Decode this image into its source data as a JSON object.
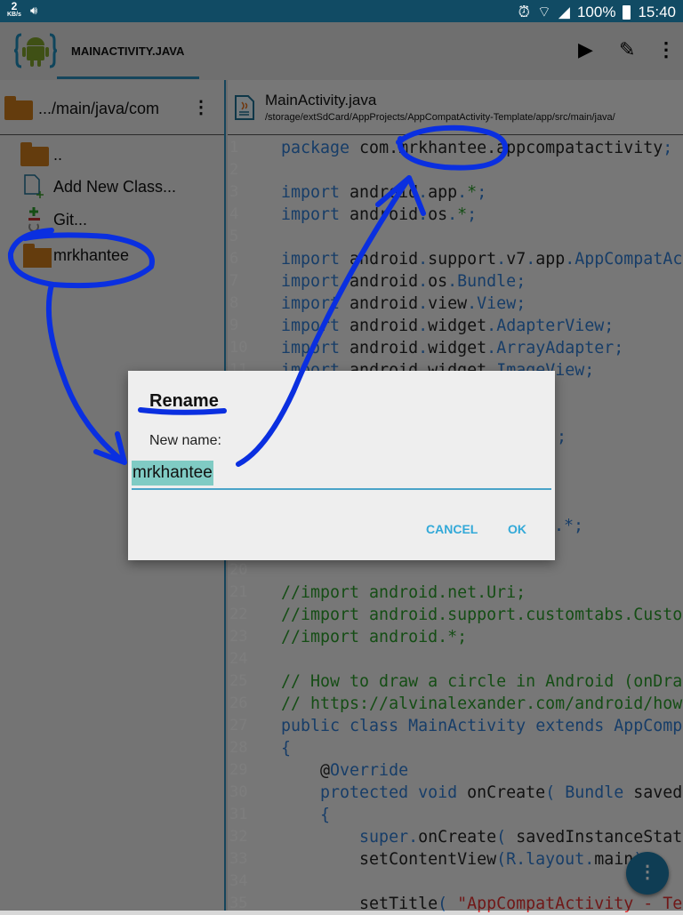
{
  "status_bar": {
    "speed": "2",
    "speed_unit": "KB/s",
    "battery": "100%",
    "time": "15:40"
  },
  "toolbar": {
    "tab_title": "MAINACTIVITY.JAVA",
    "icons": [
      "android-logo-icon",
      "play-icon",
      "pencil-icon",
      "more-vert-icon"
    ]
  },
  "sidebar": {
    "path": ".../main/java/com",
    "items": [
      {
        "label": "..",
        "icon": "folder-icon"
      },
      {
        "label": "Add New Class...",
        "icon": "new-file-icon"
      },
      {
        "label": "Git...",
        "icon": "git-icon"
      },
      {
        "label": "mrkhantee",
        "icon": "folder-icon"
      }
    ]
  },
  "editor": {
    "file_name": "MainActivity.java",
    "file_path": "/storage/extSdCard/AppProjects/AppCompatActivity-Template/app/src/main/java/",
    "lines": [
      {
        "n": "1",
        "t": [
          [
            "package",
            "k"
          ],
          [
            " com.mrkhantee.appcompatactivity",
            ""
          ],
          [
            ";",
            "p"
          ]
        ]
      },
      {
        "n": "2",
        "t": []
      },
      {
        "n": "3",
        "t": [
          [
            "import",
            "k"
          ],
          [
            " android",
            ""
          ],
          [
            ".",
            "p"
          ],
          [
            "app",
            ""
          ],
          [
            ".",
            "p"
          ],
          [
            "*",
            "c"
          ],
          [
            ";",
            "p"
          ]
        ]
      },
      {
        "n": "4",
        "t": [
          [
            "import",
            "k"
          ],
          [
            " android",
            ""
          ],
          [
            ".",
            "p"
          ],
          [
            "os",
            ""
          ],
          [
            ".",
            "p"
          ],
          [
            "*",
            "c"
          ],
          [
            ";",
            "p"
          ]
        ]
      },
      {
        "n": "5",
        "t": []
      },
      {
        "n": "6",
        "t": [
          [
            "import",
            "k"
          ],
          [
            " android",
            ""
          ],
          [
            ".",
            "p"
          ],
          [
            "support",
            ""
          ],
          [
            ".",
            "p"
          ],
          [
            "v7",
            ""
          ],
          [
            ".",
            "p"
          ],
          [
            "app",
            ""
          ],
          [
            ".",
            "p"
          ],
          [
            "AppCompatAc",
            "p"
          ]
        ]
      },
      {
        "n": "7",
        "t": [
          [
            "import",
            "k"
          ],
          [
            " android",
            ""
          ],
          [
            ".",
            "p"
          ],
          [
            "os",
            ""
          ],
          [
            ".",
            "p"
          ],
          [
            "Bundle",
            "p"
          ],
          [
            ";",
            "p"
          ]
        ]
      },
      {
        "n": "8",
        "t": [
          [
            "import",
            "k"
          ],
          [
            " android",
            ""
          ],
          [
            ".",
            "p"
          ],
          [
            "view",
            ""
          ],
          [
            ".",
            "p"
          ],
          [
            "View",
            "p"
          ],
          [
            ";",
            "p"
          ]
        ]
      },
      {
        "n": "9",
        "t": [
          [
            "import",
            "k"
          ],
          [
            " android",
            ""
          ],
          [
            ".",
            "p"
          ],
          [
            "widget",
            ""
          ],
          [
            ".",
            "p"
          ],
          [
            "AdapterView",
            "p"
          ],
          [
            ";",
            "p"
          ]
        ]
      },
      {
        "n": "10",
        "t": [
          [
            "import",
            "k"
          ],
          [
            " android",
            ""
          ],
          [
            ".",
            "p"
          ],
          [
            "widget",
            ""
          ],
          [
            ".",
            "p"
          ],
          [
            "ArrayAdapter",
            "p"
          ],
          [
            ";",
            "p"
          ]
        ]
      },
      {
        "n": "11",
        "t": [
          [
            "import",
            "k"
          ],
          [
            " android",
            ""
          ],
          [
            ".",
            "p"
          ],
          [
            "widget",
            ""
          ],
          [
            ".",
            "p"
          ],
          [
            "ImageView",
            "p"
          ],
          [
            ";",
            "p"
          ]
        ]
      },
      {
        "n": "20",
        "t": []
      },
      {
        "n": "21",
        "t": [
          [
            "//import android.net.Uri;",
            "c"
          ]
        ]
      },
      {
        "n": "22",
        "t": [
          [
            "//import android.support.customtabs.Custo",
            "c"
          ]
        ]
      },
      {
        "n": "23",
        "t": [
          [
            "//import android.*;",
            "c"
          ]
        ]
      },
      {
        "n": "24",
        "t": []
      },
      {
        "n": "25",
        "t": [
          [
            "// How to draw a circle in Android (onDra",
            "c"
          ]
        ]
      },
      {
        "n": "26",
        "t": [
          [
            "// https://alvinalexander.com/android/how",
            "c"
          ]
        ]
      },
      {
        "n": "27",
        "t": [
          [
            "public class",
            "k"
          ],
          [
            " ",
            ""
          ],
          [
            "MainActivity",
            "p"
          ],
          [
            " ",
            ""
          ],
          [
            "extends",
            "k"
          ],
          [
            " ",
            ""
          ],
          [
            "AppComp",
            "p"
          ]
        ]
      },
      {
        "n": "28",
        "t": [
          [
            "{",
            "p"
          ]
        ]
      },
      {
        "n": "29",
        "t": [
          [
            "    @",
            ""
          ],
          [
            "Override",
            "p"
          ]
        ]
      },
      {
        "n": "30",
        "t": [
          [
            "    protected void",
            "k"
          ],
          [
            " onCreate",
            ""
          ],
          [
            "( ",
            "p"
          ],
          [
            "Bundle",
            "p"
          ],
          [
            " saved",
            ""
          ]
        ]
      },
      {
        "n": "31",
        "t": [
          [
            "    {",
            "p"
          ]
        ]
      },
      {
        "n": "32",
        "t": [
          [
            "        super",
            "k"
          ],
          [
            ".",
            "p"
          ],
          [
            "onCreate",
            ""
          ],
          [
            "( ",
            "p"
          ],
          [
            "savedInstanceStat",
            ""
          ]
        ]
      },
      {
        "n": "33",
        "t": [
          [
            "        setContentView",
            ""
          ],
          [
            "(R.layout.",
            "p"
          ],
          [
            "main",
            ""
          ],
          [
            ")",
            "p"
          ]
        ]
      },
      {
        "n": "34",
        "t": []
      },
      {
        "n": "35",
        "t": [
          [
            "        setTitle",
            ""
          ],
          [
            "( ",
            "p"
          ],
          [
            "\"AppCompatActivity - Te",
            "s"
          ]
        ]
      }
    ],
    "hidden_fragments": [
      {
        "line": "14",
        "text": ";"
      },
      {
        "line": "18",
        "text": "ntent.*;"
      }
    ]
  },
  "dialog": {
    "title": "Rename",
    "label": "New name:",
    "value": "mrkhantee",
    "cancel": "CANCEL",
    "ok": "OK"
  },
  "colors": {
    "status_bar": "#114b64",
    "accent": "#33a9d8",
    "annotation": "#0a2fe0",
    "selection": "#80cbc4"
  }
}
